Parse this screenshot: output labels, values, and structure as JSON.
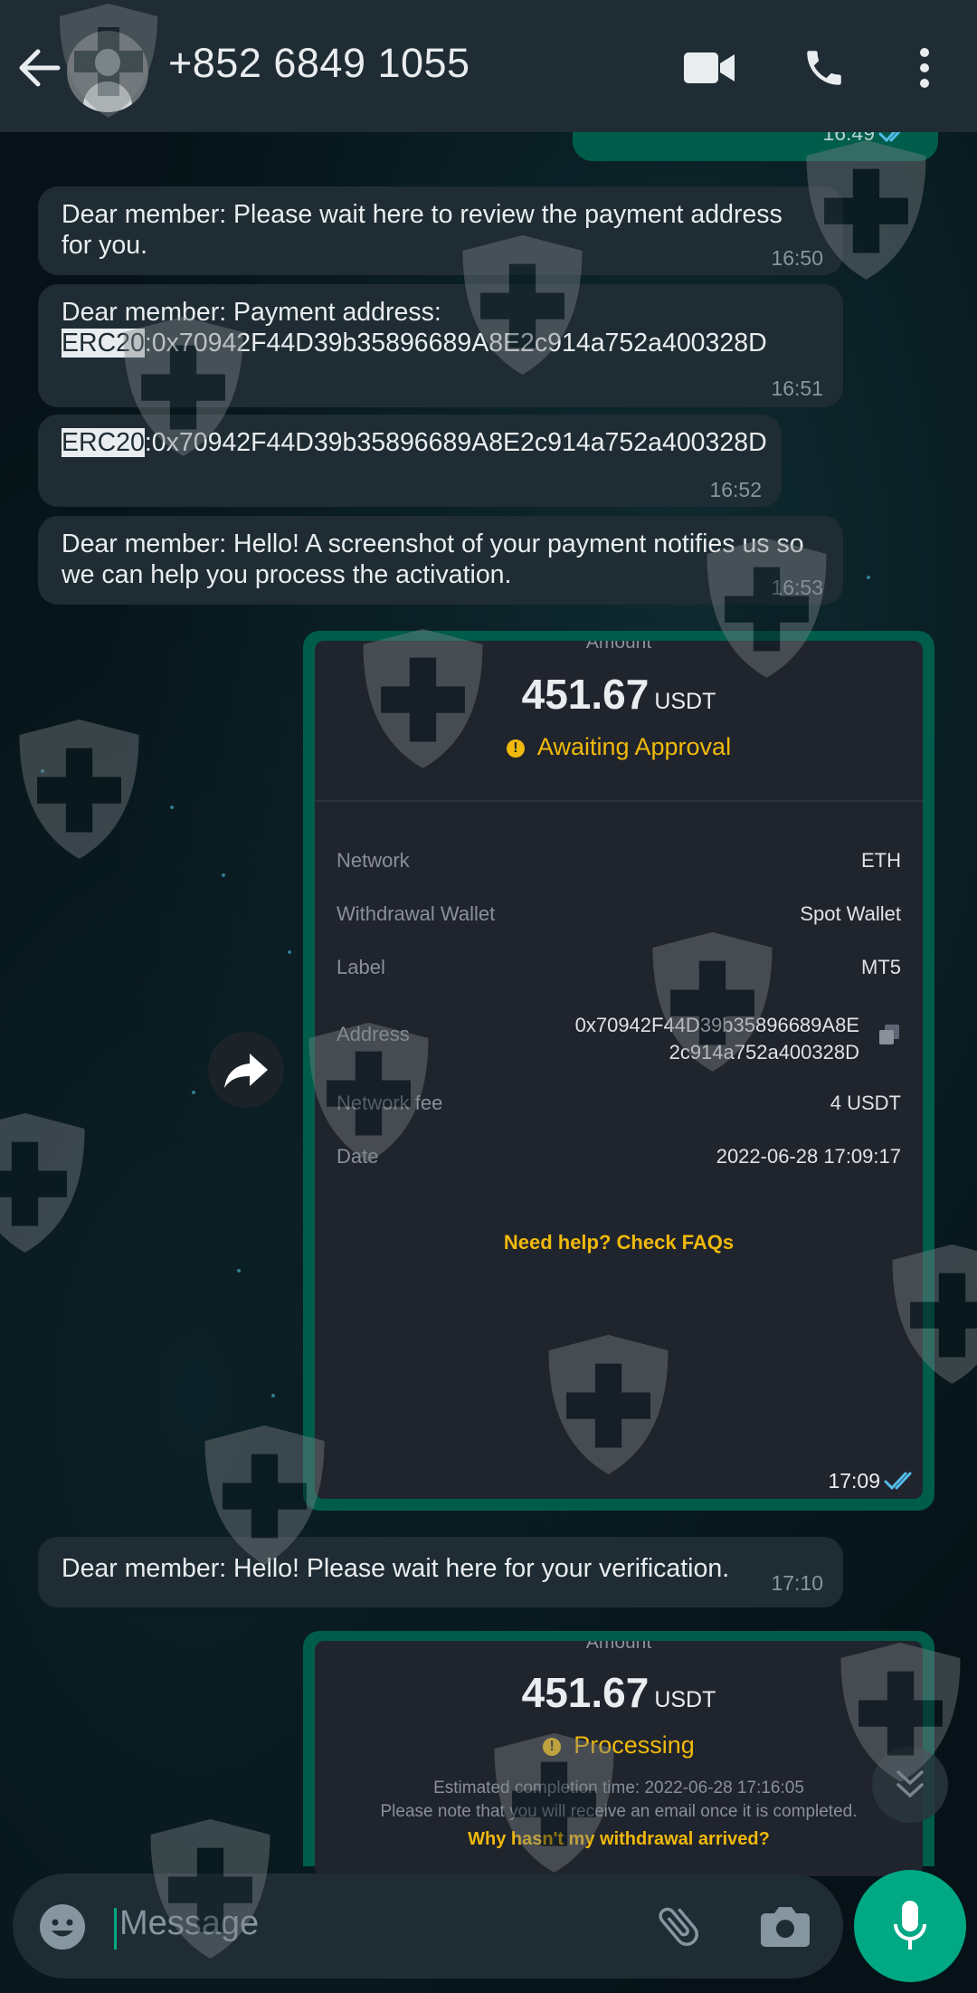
{
  "header": {
    "contact_name": "+852 6849 1055",
    "icons": [
      "back-arrow-icon",
      "avatar",
      "video-call-icon",
      "phone-icon",
      "more-vert-icon"
    ]
  },
  "partial_message": {
    "time": "16:49"
  },
  "messages": [
    {
      "text": "Dear member: Please wait here to review the payment address for you.",
      "time": "16:50"
    },
    {
      "line1": "Dear member: Payment address:",
      "tag": "ERC20",
      "address": ":0x70942F44D39b35896689A8E2c914a752a400328D",
      "time": "16:51"
    },
    {
      "tag": "ERC20",
      "address": ":0x70942F44D39b35896689A8E2c914a752a400328D",
      "time": "16:52"
    },
    {
      "text": "Dear member: Hello! A screenshot of your payment notifies us so we can help you process the activation.",
      "time": "16:53"
    },
    {
      "text": "Dear member: Hello! Please wait here for your verification.",
      "time": "17:10"
    }
  ],
  "image1": {
    "amount_label": "Amount",
    "amount": "451.67",
    "unit": "USDT",
    "status": "Awaiting Approval",
    "rows": [
      {
        "key": "Network",
        "value": "ETH"
      },
      {
        "key": "Withdrawal Wallet",
        "value": "Spot Wallet"
      },
      {
        "key": "Label",
        "value": "MT5"
      },
      {
        "key": "Address",
        "value_line1": "0x70942F44D39b35896689A8E",
        "value_line2": "2c914a752a400328D"
      },
      {
        "key": "Network fee",
        "value": "4 USDT"
      },
      {
        "key": "Date",
        "value": "2022-06-28 17:09:17"
      }
    ],
    "faq": "Need help? Check FAQs",
    "time": "17:09"
  },
  "image2": {
    "amount_label": "Amount",
    "amount": "451.67",
    "unit": "USDT",
    "status": "Processing",
    "eta": "Estimated completion time: 2022-06-28 17:16:05",
    "note": "Please note that you will receive an email once it is completed.",
    "help": "Why hasn't my withdrawal arrived?"
  },
  "input": {
    "placeholder": "Message"
  },
  "colors": {
    "header": "#1f2c34",
    "incoming": "#1f2c34",
    "outgoing": "#005c4b",
    "accent": "#00a884",
    "binance_yellow": "#f0b90b"
  }
}
